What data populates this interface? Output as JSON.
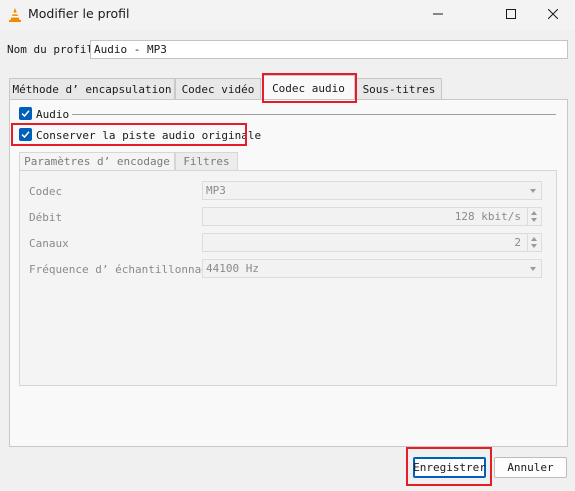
{
  "window": {
    "title": "Modifier le profil",
    "controls": {
      "minimize_icon": "minimize-icon",
      "maximize_icon": "maximize-icon",
      "close_icon": "close-icon"
    }
  },
  "profile": {
    "label": "Nom du profil",
    "value": "Audio - MP3"
  },
  "tabs": [
    {
      "label": "Méthode d’ encapsulation",
      "active": false
    },
    {
      "label": "Codec vidéo",
      "active": false
    },
    {
      "label": "Codec audio",
      "active": true
    },
    {
      "label": "Sous-titres",
      "active": false
    }
  ],
  "audio": {
    "enable_label": "Audio",
    "enable_checked": true,
    "keep_original_label": "Conserver la piste audio originale",
    "keep_original_checked": true
  },
  "subtabs": [
    {
      "label": "Paramètres d’ encodage",
      "active": true
    },
    {
      "label": "Filtres",
      "active": false
    }
  ],
  "form": {
    "codec": {
      "label": "Codec",
      "value": "MP3"
    },
    "bitrate": {
      "label": "Débit",
      "value": "128 kbit/s"
    },
    "channels": {
      "label": "Canaux",
      "value": "2"
    },
    "samplerate": {
      "label": "Fréquence d’ échantillonnage",
      "value": "44100 Hz"
    }
  },
  "buttons": {
    "save": "Enregistrer",
    "cancel": "Annuler"
  },
  "colors": {
    "accent": "#005fb8",
    "highlight": "#e41e26",
    "vlc_orange": "#f08a00"
  }
}
